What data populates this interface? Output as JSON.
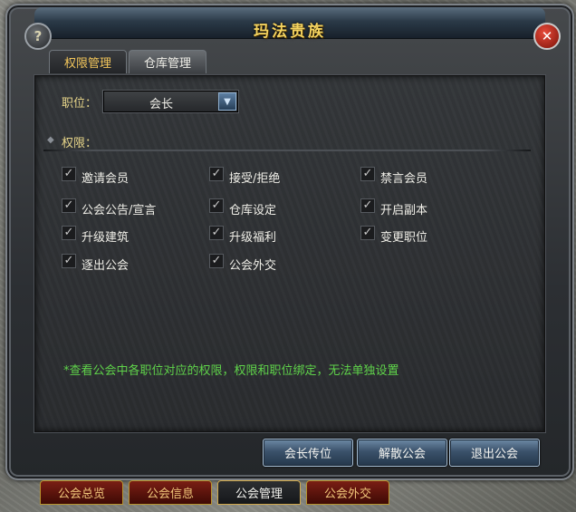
{
  "window": {
    "title": "玛法贵族"
  },
  "icons": {
    "help": "?",
    "close": "✕",
    "dropdown": "▼",
    "check": "✓",
    "section": "◆"
  },
  "tabs": [
    {
      "label": "权限管理",
      "active": true
    },
    {
      "label": "仓库管理",
      "active": false
    }
  ],
  "position": {
    "label": "职位：",
    "value": "会长"
  },
  "permissions": {
    "label": "权限：",
    "items": [
      {
        "label": "邀请会员",
        "checked": true
      },
      {
        "label": "接受/拒绝",
        "checked": true
      },
      {
        "label": "禁言会员",
        "checked": true
      },
      {
        "label": "公会公告/宣言",
        "checked": true
      },
      {
        "label": "仓库设定",
        "checked": true
      },
      {
        "label": "开启副本",
        "checked": true
      },
      {
        "label": "升级建筑",
        "checked": true
      },
      {
        "label": "升级福利",
        "checked": true
      },
      {
        "label": "变更职位",
        "checked": true
      },
      {
        "label": "逐出公会",
        "checked": true
      },
      {
        "label": "公会外交",
        "checked": true
      }
    ]
  },
  "note": "*查看公会中各职位对应的权限，权限和职位绑定，无法单独设置",
  "buttons": {
    "transfer": "会长传位",
    "disband": "解散公会",
    "leave": "退出公会"
  },
  "bottom_tabs": [
    {
      "label": "公会总览",
      "active": false
    },
    {
      "label": "公会信息",
      "active": false
    },
    {
      "label": "公会管理",
      "active": true
    },
    {
      "label": "公会外交",
      "active": false
    }
  ],
  "colors": {
    "accent_gold": "#f3c65b",
    "note_green": "#5fd34a",
    "button_blue": "#3b526b",
    "tab_red": "#7a1e14"
  }
}
